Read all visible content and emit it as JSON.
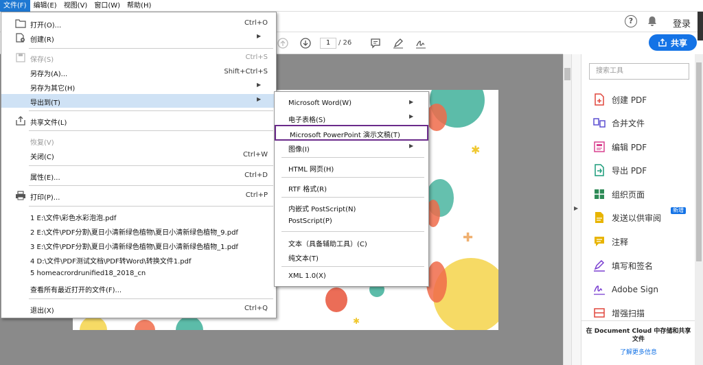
{
  "menubar": {
    "file": "文件(F)",
    "edit": "编辑(E)",
    "view": "视图(V)",
    "window": "窗口(W)",
    "help": "帮助(H)"
  },
  "header": {
    "login": "登录",
    "share": "共享",
    "help": "?"
  },
  "toolbar": {
    "page": "1",
    "total": "/ 26"
  },
  "file_menu": {
    "open": {
      "label": "打开(O)...",
      "shortcut": "Ctrl+O"
    },
    "create": {
      "label": "创建(R)"
    },
    "save": {
      "label": "保存(S)",
      "shortcut": "Ctrl+S"
    },
    "save_as": {
      "label": "另存为(A)...",
      "shortcut": "Shift+Ctrl+S"
    },
    "save_as_other": {
      "label": "另存为其它(H)"
    },
    "export_to": {
      "label": "导出到(T)"
    },
    "share_file": {
      "label": "共享文件(L)"
    },
    "revert": {
      "label": "恢复(V)"
    },
    "close": {
      "label": "关闭(C)",
      "shortcut": "Ctrl+W"
    },
    "properties": {
      "label": "属性(E)...",
      "shortcut": "Ctrl+D"
    },
    "print": {
      "label": "打印(P)...",
      "shortcut": "Ctrl+P"
    },
    "recent": [
      "1 E:\\文件\\彩色水彩泡泡.pdf",
      "2 E:\\文件\\PDF分割\\夏日小清新绿色植物\\夏日小清新绿色植物_9.pdf",
      "3 E:\\文件\\PDF分割\\夏日小清新绿色植物\\夏日小清新绿色植物_1.pdf",
      "4 D:\\文件\\PDF测试文档\\PDF转Word\\转换文件1.pdf",
      "5 homeacrordrunified18_2018_cn"
    ],
    "view_all_recent": {
      "label": "查看所有最近打开的文件(F)..."
    },
    "exit": {
      "label": "退出(X)",
      "shortcut": "Ctrl+Q"
    }
  },
  "export_submenu": {
    "word": "Microsoft Word(W)",
    "spreadsheet": "电子表格(S)",
    "powerpoint": "Microsoft PowerPoint 演示文稿(T)",
    "image": "图像(I)",
    "html": "HTML 网页(H)",
    "rtf": "RTF 格式(R)",
    "eps": "内嵌式 PostScript(N)",
    "postscript": "PostScript(P)",
    "accessible_text": "文本（具备辅助工具）(C)",
    "plain_text": "纯文本(T)",
    "xml": "XML 1.0(X)"
  },
  "tools_panel": {
    "search_placeholder": "搜索工具",
    "items": [
      {
        "label": "创建 PDF",
        "color": "#e0463c"
      },
      {
        "label": "合并文件",
        "color": "#5b4ed1"
      },
      {
        "label": "编辑 PDF",
        "color": "#d9408f"
      },
      {
        "label": "导出 PDF",
        "color": "#1a9c7a"
      },
      {
        "label": "组织页面",
        "color": "#2e8b57"
      },
      {
        "label": "发送以供审阅",
        "color": "#e8b400"
      },
      {
        "label": "注释",
        "color": "#e8b400"
      },
      {
        "label": "填写和签名",
        "color": "#7a3fd1"
      },
      {
        "label": "Adobe Sign",
        "color": "#7a3fd1"
      },
      {
        "label": "增强扫描",
        "color": "#e0463c"
      }
    ],
    "new_badge": "新增",
    "cloud_text": "在 Document Cloud 中存储和共享文件",
    "learn_more": "了解更多信息"
  }
}
